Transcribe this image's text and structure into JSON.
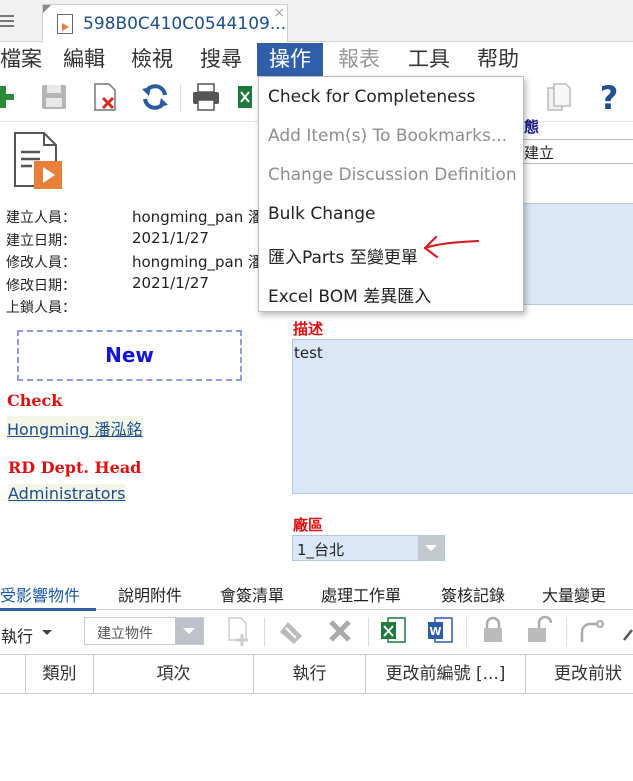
{
  "tab": {
    "title": "598B0C410C0544109...",
    "close": "×"
  },
  "menu": {
    "items": [
      {
        "label": "檔案"
      },
      {
        "label": "編輯"
      },
      {
        "label": "檢視"
      },
      {
        "label": "搜尋"
      },
      {
        "label": "操作"
      },
      {
        "label": "報表"
      },
      {
        "label": "工具"
      },
      {
        "label": "帮助"
      }
    ]
  },
  "dropdown": {
    "items": [
      {
        "label": "Check for Completeness"
      },
      {
        "label": "Add Item(s) To Bookmarks..."
      },
      {
        "label": "Change Discussion Definition"
      },
      {
        "label": "Bulk Change"
      },
      {
        "label": "匯入Parts 至變更單"
      },
      {
        "label": "Excel BOM 差異匯入"
      }
    ]
  },
  "info": {
    "creator_label": "建立人員：",
    "creator_value": "hongming_pan 潘",
    "created_label": "建立日期：",
    "created_value": "2021/1/27",
    "modifier_label": "修改人員：",
    "modifier_value": "hongming_pan 潘",
    "modified_label": "修改日期：",
    "modified_value": "2021/1/27",
    "locker_label": "上鎖人員："
  },
  "status_box": "New",
  "workflow": {
    "check_heading": "Check",
    "check_user": "Hongming 潘泓銘",
    "head_heading": "RD Dept. Head",
    "head_user": "Administrators"
  },
  "right": {
    "status_partial": "態",
    "status_value_partial": "斤建立",
    "description_label": "描述",
    "description_value": "test",
    "plant_label": "廠區",
    "plant_value": "1_台北"
  },
  "subtabs": [
    "受影響物件",
    "說明附件",
    "會簽清單",
    "處理工作單",
    "簽核記錄",
    "大量變更"
  ],
  "subtoolbar": {
    "execute_label": "執行",
    "create_select": "建立物件"
  },
  "grid": {
    "headers": [
      "類別",
      "項次",
      "執行",
      "更改前編號 [...]",
      "更改前狀"
    ]
  },
  "colors": {
    "accent": "#2f5fa8",
    "link": "#1a4e8a",
    "required": "#dd1111",
    "field_bg": "#dbe6f6",
    "annotation": "#d42020"
  }
}
